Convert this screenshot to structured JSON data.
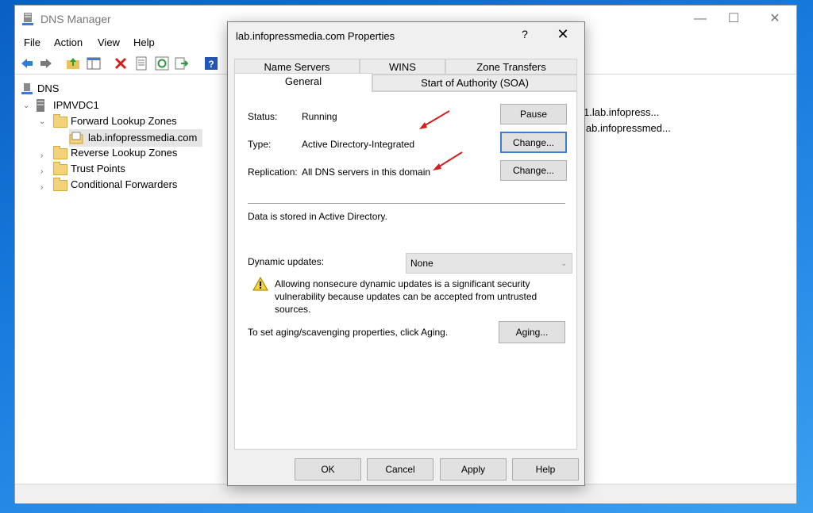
{
  "app": {
    "title": "DNS Manager",
    "window_controls": {
      "minimize": "—",
      "maximize": "☐",
      "close": "✕"
    }
  },
  "menu": [
    "File",
    "Action",
    "View",
    "Help"
  ],
  "toolbar": {
    "icons": [
      "back-arrow-icon",
      "forward-arrow-icon",
      "up-folder-icon",
      "show-hide-tree-icon",
      "delete-icon",
      "properties-icon",
      "refresh-icon",
      "export-list-icon",
      "help-icon"
    ]
  },
  "tree": {
    "root": "DNS",
    "server": "IPMVDC1",
    "forward_zones": "Forward Lookup Zones",
    "zone": "lab.infopressmedia.com",
    "reverse_zones": "Reverse Lookup Zones",
    "trust_points": "Trust Points",
    "conditional_forwarders": "Conditional Forwarders"
  },
  "right_pane": [
    "1.lab.infopress...",
    "lab.infopressmed..."
  ],
  "dialog": {
    "title": "lab.infopressmedia.com Properties",
    "help_glyph": "?",
    "close_glyph": "✕",
    "tabs_back": [
      "Name Servers",
      "WINS",
      "Zone Transfers"
    ],
    "tabs_front": [
      "General",
      "Start of Authority (SOA)"
    ],
    "status_label": "Status:",
    "status_value": "Running",
    "pause_button": "Pause",
    "type_label": "Type:",
    "type_value": "Active Directory-Integrated",
    "type_change_button": "Change...",
    "replication_label": "Replication:",
    "replication_value": "All DNS servers in this domain",
    "replication_change_button": "Change...",
    "storage_note": "Data is stored in Active Directory.",
    "dynamic_updates_label": "Dynamic updates:",
    "dynamic_updates_value": "None",
    "warning_line1": "Allowing nonsecure dynamic updates is a significant security",
    "warning_line2": "vulnerability because updates can be accepted from untrusted",
    "warning_line3": "sources.",
    "aging_text": "To set aging/scavenging properties, click Aging.",
    "aging_button": "Aging...",
    "ok_button": "OK",
    "cancel_button": "Cancel",
    "apply_button": "Apply",
    "help_button": "Help"
  },
  "colors": {
    "accent": "#3c7fd5",
    "annotation_arrow": "#d11f1f",
    "desktop": "#1a7ee0"
  }
}
